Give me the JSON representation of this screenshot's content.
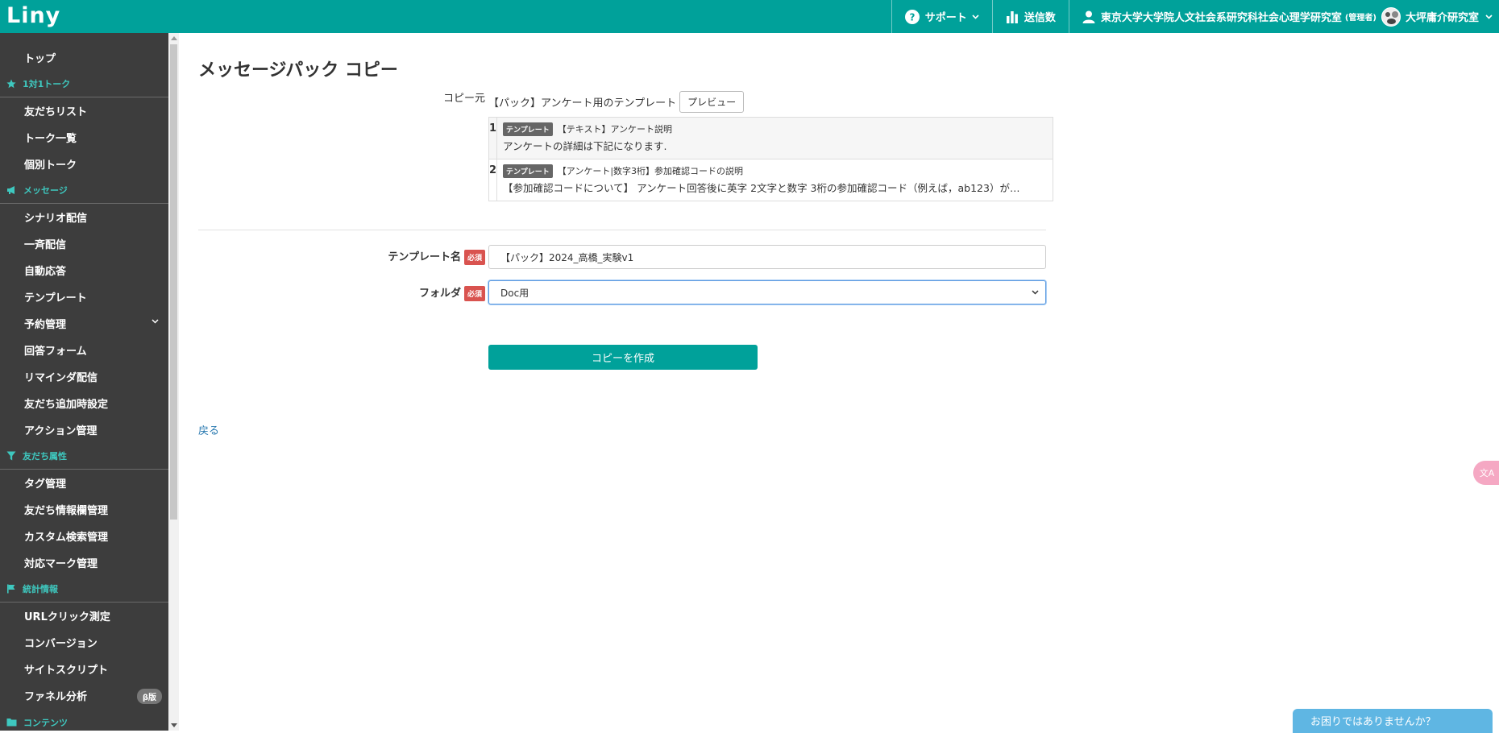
{
  "header": {
    "logo": "Liny",
    "support_label": "サポート",
    "send_count_label": "送信数",
    "account_name": "東京大学大学院人文社会系研究科社会心理学研究室",
    "account_role": "(管理者)",
    "user_name": "大坪庸介研究室"
  },
  "sidebar": {
    "items": [
      {
        "type": "item",
        "label": "トップ"
      },
      {
        "type": "category",
        "label": "1対1トーク",
        "icon": "star-icon"
      },
      {
        "type": "item",
        "label": "友だちリスト"
      },
      {
        "type": "item",
        "label": "トーク一覧"
      },
      {
        "type": "item",
        "label": "個別トーク"
      },
      {
        "type": "category",
        "label": "メッセージ",
        "icon": "megaphone-icon"
      },
      {
        "type": "item",
        "label": "シナリオ配信"
      },
      {
        "type": "item",
        "label": "一斉配信"
      },
      {
        "type": "item",
        "label": "自動応答"
      },
      {
        "type": "item",
        "label": "テンプレート"
      },
      {
        "type": "item",
        "label": "予約管理",
        "chevron": true
      },
      {
        "type": "item",
        "label": "回答フォーム"
      },
      {
        "type": "item",
        "label": "リマインダ配信"
      },
      {
        "type": "item",
        "label": "友だち追加時設定"
      },
      {
        "type": "item",
        "label": "アクション管理"
      },
      {
        "type": "category",
        "label": "友だち属性",
        "icon": "filter-icon"
      },
      {
        "type": "item",
        "label": "タグ管理"
      },
      {
        "type": "item",
        "label": "友だち情報欄管理"
      },
      {
        "type": "item",
        "label": "カスタム検索管理"
      },
      {
        "type": "item",
        "label": "対応マーク管理"
      },
      {
        "type": "category",
        "label": "統計情報",
        "icon": "flag-icon"
      },
      {
        "type": "item",
        "label": "URLクリック測定"
      },
      {
        "type": "item",
        "label": "コンバージョン"
      },
      {
        "type": "item",
        "label": "サイトスクリプト"
      },
      {
        "type": "item",
        "label": "ファネル分析",
        "badge": "β版"
      },
      {
        "type": "category",
        "label": "コンテンツ",
        "icon": "folder-icon"
      }
    ]
  },
  "main": {
    "title": "メッセージパック コピー",
    "source_label": "コピー元",
    "source_name": "【パック】アンケート用のテンプレート",
    "preview_button": "プレビュー",
    "pack_items": [
      {
        "num": "1",
        "badge": "テンプレート",
        "title": "【テキスト】アンケート説明",
        "body": "アンケートの詳細は下記になります."
      },
      {
        "num": "2",
        "badge": "テンプレート",
        "title": "【アンケート|数字3桁】参加確認コードの説明",
        "body": "【参加確認コードについて】 アンケート回答後に英字 2文字と数字 3桁の参加確認コード（例えば，ab123）が…"
      }
    ],
    "template_name_label": "テンプレート名",
    "folder_label": "フォルダ",
    "required_badge": "必須",
    "template_name_value": "【パック】2024_高橋_実験v1",
    "folder_value": "Doc用",
    "create_button": "コピーを作成",
    "back_link": "戻る"
  },
  "widgets": {
    "translate_label": "文A",
    "help_label": "お困りではありませんか？"
  },
  "colors": {
    "brand": "#00a19a",
    "sidebar_bg": "#3d3d3d",
    "sidebar_category": "#3ec8bf",
    "required": "#d9534f",
    "link": "#2a7ab0"
  }
}
